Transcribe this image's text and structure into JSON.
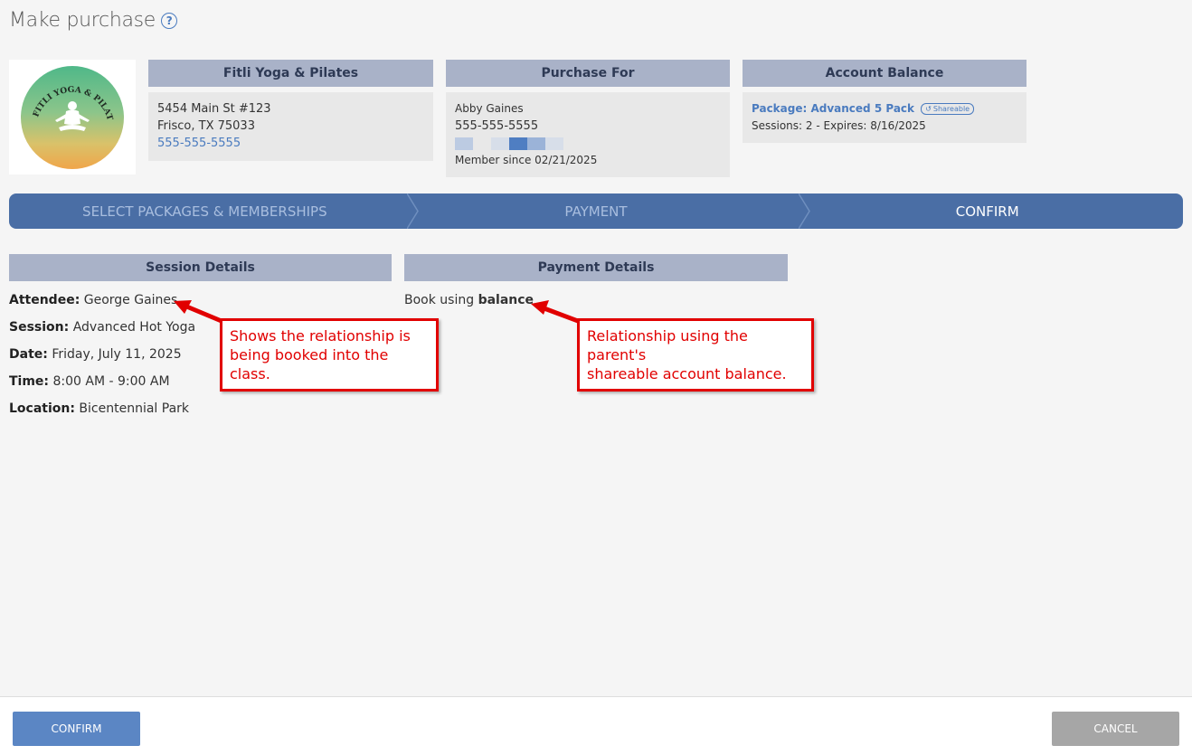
{
  "page": {
    "title": "Make purchase"
  },
  "studio": {
    "card_title": "Fitli Yoga & Pilates",
    "address1": "5454 Main St #123",
    "address2": "Frisco, TX 75033",
    "phone": "555-555-5555",
    "logo_text": "FITLI YOGA & PILATES"
  },
  "purchase_for": {
    "card_title": "Purchase For",
    "name": "Abby Gaines",
    "phone": "555-555-5555",
    "member_since": "Member since 02/21/2025"
  },
  "account_balance": {
    "card_title": "Account Balance",
    "package": "Package: Advanced 5 Pack",
    "badge": "Shareable",
    "sessions": "Sessions: 2 -  Expires: 8/16/2025"
  },
  "steps": [
    {
      "label": "SELECT PACKAGES & MEMBERSHIPS",
      "active": false
    },
    {
      "label": "PAYMENT",
      "active": false
    },
    {
      "label": "CONFIRM",
      "active": true
    }
  ],
  "session_details": {
    "heading": "Session Details",
    "attendee_label": "Attendee:",
    "attendee": "George Gaines",
    "session_label": "Session:",
    "session": "Advanced Hot Yoga",
    "date_label": "Date:",
    "date": "Friday, July 11, 2025",
    "time_label": "Time:",
    "time": "8:00 AM - 9:00 AM",
    "location_label": "Location:",
    "location": "Bicentennial Park"
  },
  "payment_details": {
    "heading": "Payment Details",
    "book_using": "Book using",
    "method": "balance"
  },
  "callouts": {
    "attendee_note_1": "Shows the relationship is",
    "attendee_note_2": "being booked into the class.",
    "payment_note_1": "Relationship using the parent's",
    "payment_note_2": "shareable account balance."
  },
  "footer": {
    "confirm_label": "CONFIRM",
    "cancel_label": "CANCEL"
  },
  "colors": {
    "accent": "#4a6ea5",
    "header_band": "#a9b2c8",
    "callout_red": "#e10000",
    "link": "#4a7bbf"
  }
}
